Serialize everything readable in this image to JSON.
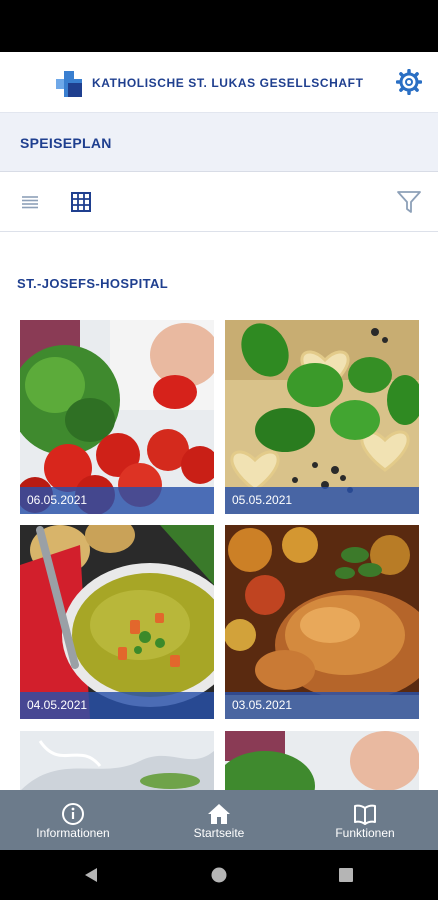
{
  "header": {
    "brand": "KATHOLISCHE ST. LUKAS GESELLSCHAFT",
    "accent_color": "#1f3f8f",
    "settings_icon": "gear-icon"
  },
  "page": {
    "title": "SPEISEPLAN"
  },
  "view_toolbar": {
    "list_icon": "list-icon",
    "grid_icon": "grid-icon",
    "filter_icon": "filter-icon"
  },
  "section": {
    "title": "ST.-JOSEFS-HOSPITAL"
  },
  "menu_tiles": [
    {
      "date": "06.05.2021",
      "image": "vegetables"
    },
    {
      "date": "05.05.2021",
      "image": "basil-pasta"
    },
    {
      "date": "04.05.2021",
      "image": "soup"
    },
    {
      "date": "03.05.2021",
      "image": "roast-chicken"
    },
    {
      "date": "",
      "image": "water-splash"
    },
    {
      "date": "",
      "image": "vegetables"
    }
  ],
  "bottom_nav": [
    {
      "label": "Informationen",
      "icon": "info-icon"
    },
    {
      "label": "Startseite",
      "icon": "home-icon"
    },
    {
      "label": "Funktionen",
      "icon": "book-icon"
    }
  ],
  "system_nav": {
    "back_icon": "back-icon",
    "home_icon": "home-circle-icon",
    "recents_icon": "recents-icon"
  }
}
